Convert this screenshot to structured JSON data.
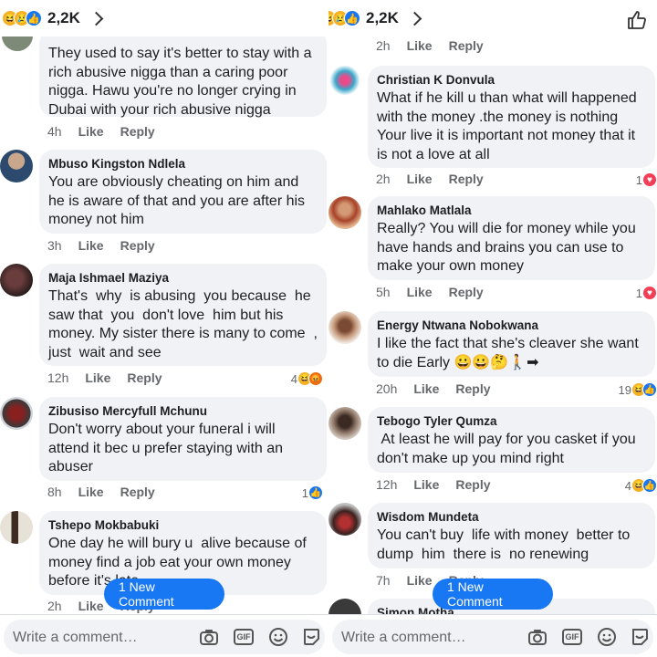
{
  "left": {
    "reaction_count": "2,2K",
    "new_comment_label": "1 New Comment",
    "input_placeholder": "Write a comment…",
    "partial_top": {
      "text": "They used to say it's better to stay with a rich abusive nigga than a caring poor nigga. Hawu you're no longer crying in Dubai with your rich abusive nigga",
      "time": "4h",
      "like": "Like",
      "reply": "Reply"
    },
    "comments": [
      {
        "author": "Mbuso Kingston Ndlela",
        "text": "You are obviously cheating on him and he is aware of that and you are after his money not him",
        "time": "3h",
        "like": "Like",
        "reply": "Reply",
        "react_count": ""
      },
      {
        "author": "Maja Ishmael Maziya",
        "text": "That's  why  is abusing  you because  he saw that  you  don't love  him but his money. My sister there is many to come  , just  wait and see",
        "time": "12h",
        "like": "Like",
        "reply": "Reply",
        "react_count": "4"
      },
      {
        "author": "Zibusiso Mercyfull Mchunu",
        "text": "Don't worry about your funeral i will attend it bec u prefer staying with an abuser",
        "time": "8h",
        "like": "Like",
        "reply": "Reply",
        "react_count": "1"
      },
      {
        "author": "Tshepo Mokbabuki",
        "text": "One day he will bury u  alive because of money find a job eat your own money before it's late",
        "time": "2h",
        "like": "Like",
        "reply": "Reply",
        "react_count": ""
      }
    ]
  },
  "right": {
    "reaction_count": "2,2K",
    "new_comment_label": "1 New Comment",
    "input_placeholder": "Write a comment…",
    "partial_top": {
      "time": "2h",
      "like": "Like",
      "reply": "Reply"
    },
    "comments": [
      {
        "author": "Christian K Donvula",
        "text": "What if he kill u than what will happened with the money .the money is nothing Your live it is important not money that it is not a love at all",
        "time": "2h",
        "like": "Like",
        "reply": "Reply",
        "react_count": "1"
      },
      {
        "author": "Mahlako Matlala",
        "text": "Really? You will die for money while you have hands and brains you can use to make your own money",
        "time": "5h",
        "like": "Like",
        "reply": "Reply",
        "react_count": "1"
      },
      {
        "author": "Energy Ntwana Nobokwana",
        "text": "I like the fact that she's cleaver she want to die Early 😀😀🤔🚶➡",
        "time": "20h",
        "like": "Like",
        "reply": "Reply",
        "react_count": "19"
      },
      {
        "author": "Tebogo Tyler Qumza",
        "text": " At least he will pay for you casket if you don't make up you mind right",
        "time": "12h",
        "like": "Like",
        "reply": "Reply",
        "react_count": "4"
      },
      {
        "author": "Wisdom Mundeta",
        "text": "You can't buy  life with money  better to dump  him  there is  no renewing",
        "time": "7h",
        "like": "Like",
        "reply": "Reply",
        "react_count": ""
      },
      {
        "author": "Simon Motha",
        "text": "",
        "time": "",
        "like": "",
        "reply": "",
        "react_count": ""
      }
    ]
  },
  "icons": [
    "like-icon",
    "haha-icon",
    "sad-icon",
    "angry-icon",
    "love-icon",
    "chevron-right-icon",
    "thumbs-up-outline-icon",
    "camera-icon",
    "gif-icon",
    "emoji-icon",
    "sticker-icon"
  ]
}
